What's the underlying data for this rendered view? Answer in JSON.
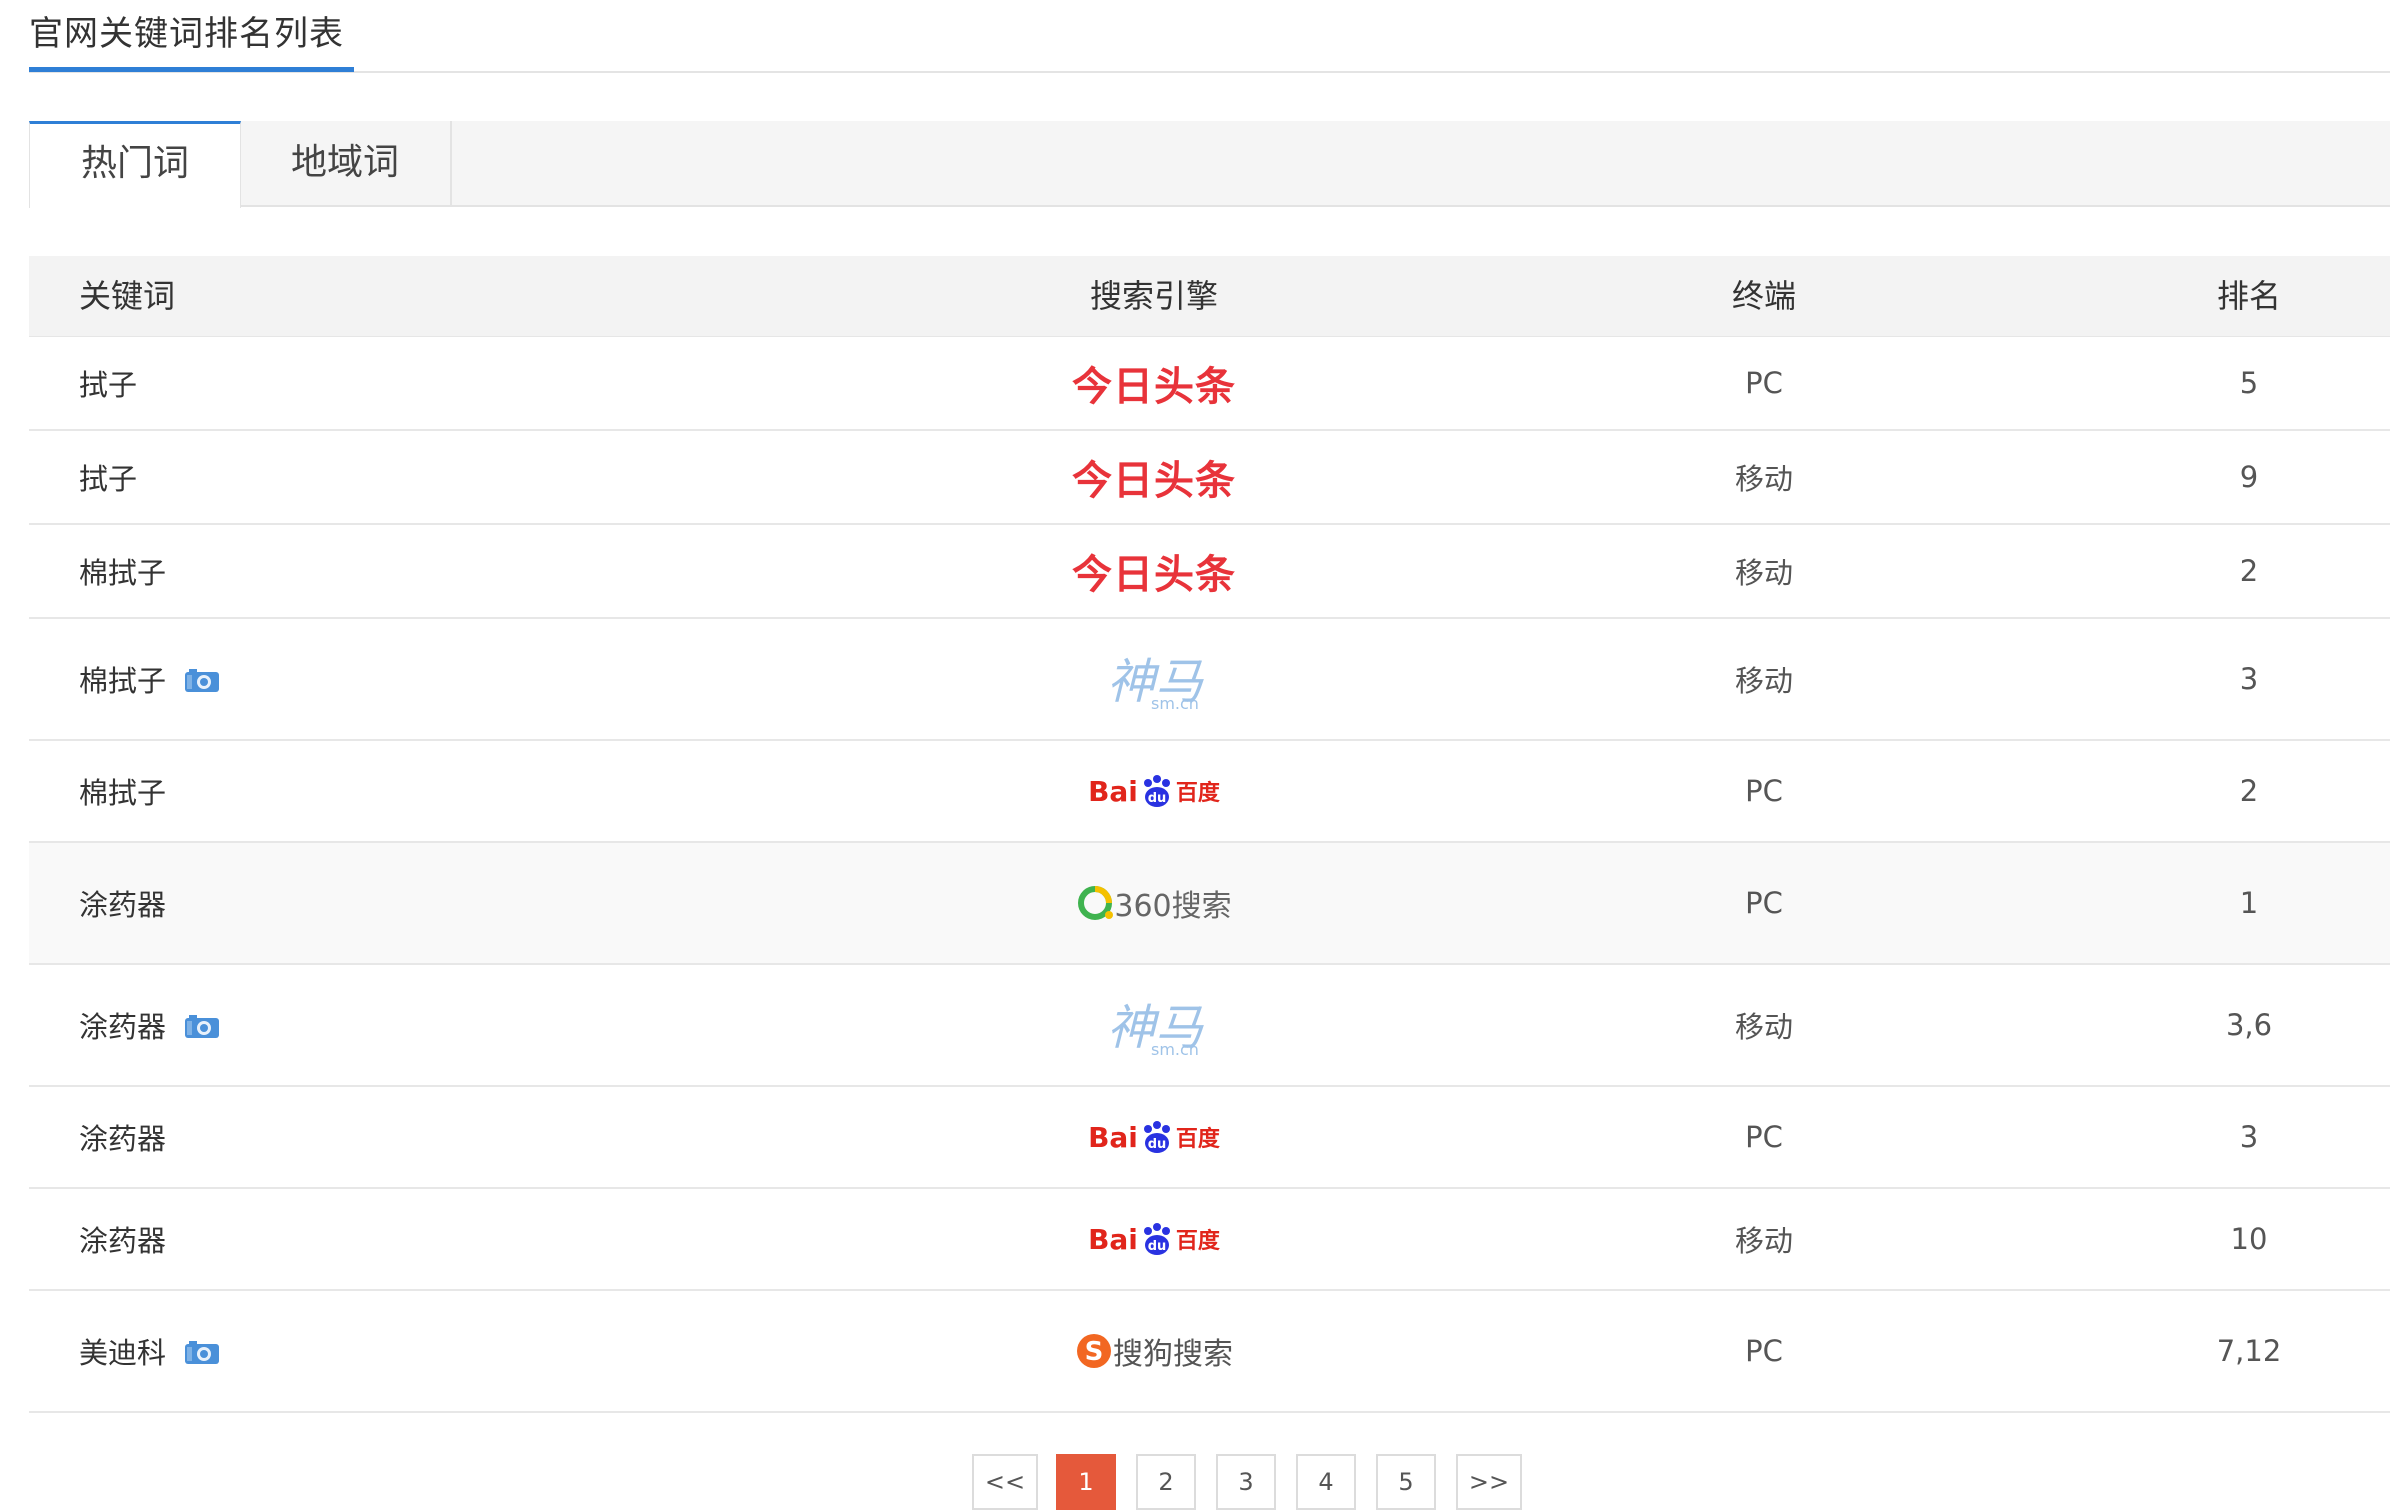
{
  "header": {
    "title": "官网关键词排名列表"
  },
  "tabs": [
    {
      "label": "热门词",
      "active": true
    },
    {
      "label": "地域词",
      "active": false
    }
  ],
  "table": {
    "columns": [
      "关键词",
      "搜索引擎",
      "终端",
      "排名"
    ],
    "rows": [
      {
        "keyword": "拭子",
        "snapshot": false,
        "engine": "今日头条",
        "terminal": "PC",
        "rank": "5"
      },
      {
        "keyword": "拭子",
        "snapshot": false,
        "engine": "今日头条",
        "terminal": "移动",
        "rank": "9"
      },
      {
        "keyword": "棉拭子",
        "snapshot": false,
        "engine": "今日头条",
        "terminal": "移动",
        "rank": "2"
      },
      {
        "keyword": "棉拭子",
        "snapshot": true,
        "engine": "神马",
        "engine_sub": "sm.cn",
        "terminal": "移动",
        "rank": "3"
      },
      {
        "keyword": "棉拭子",
        "snapshot": false,
        "engine_bai": "Bai",
        "engine_du": "du",
        "engine": "百度",
        "terminal": "PC",
        "rank": "2"
      },
      {
        "keyword": "涂药器",
        "snapshot": false,
        "engine": "360搜索",
        "terminal": "PC",
        "rank": "1"
      },
      {
        "keyword": "涂药器",
        "snapshot": true,
        "engine": "神马",
        "engine_sub": "sm.cn",
        "terminal": "移动",
        "rank": "3,6"
      },
      {
        "keyword": "涂药器",
        "snapshot": false,
        "engine_bai": "Bai",
        "engine_du": "du",
        "engine": "百度",
        "terminal": "PC",
        "rank": "3"
      },
      {
        "keyword": "涂药器",
        "snapshot": false,
        "engine_bai": "Bai",
        "engine_du": "du",
        "engine": "百度",
        "terminal": "移动",
        "rank": "10"
      },
      {
        "keyword": "美迪科",
        "snapshot": true,
        "engine": "搜狗搜索",
        "terminal": "PC",
        "rank": "7,12"
      }
    ]
  },
  "pagination": {
    "prev": "<<",
    "pages": [
      "1",
      "2",
      "3",
      "4",
      "5"
    ],
    "current": "1",
    "next": ">>"
  },
  "colors": {
    "accent": "#2f7fd6",
    "toutiao_red": "#e8333a",
    "shenma_blue": "#9fc3e8",
    "baidu_red": "#e1251b",
    "baidu_blue": "#2932e1",
    "pager_active": "#e5593b",
    "so360_green": "#3fb34f",
    "sogou_orange": "#f26722"
  }
}
